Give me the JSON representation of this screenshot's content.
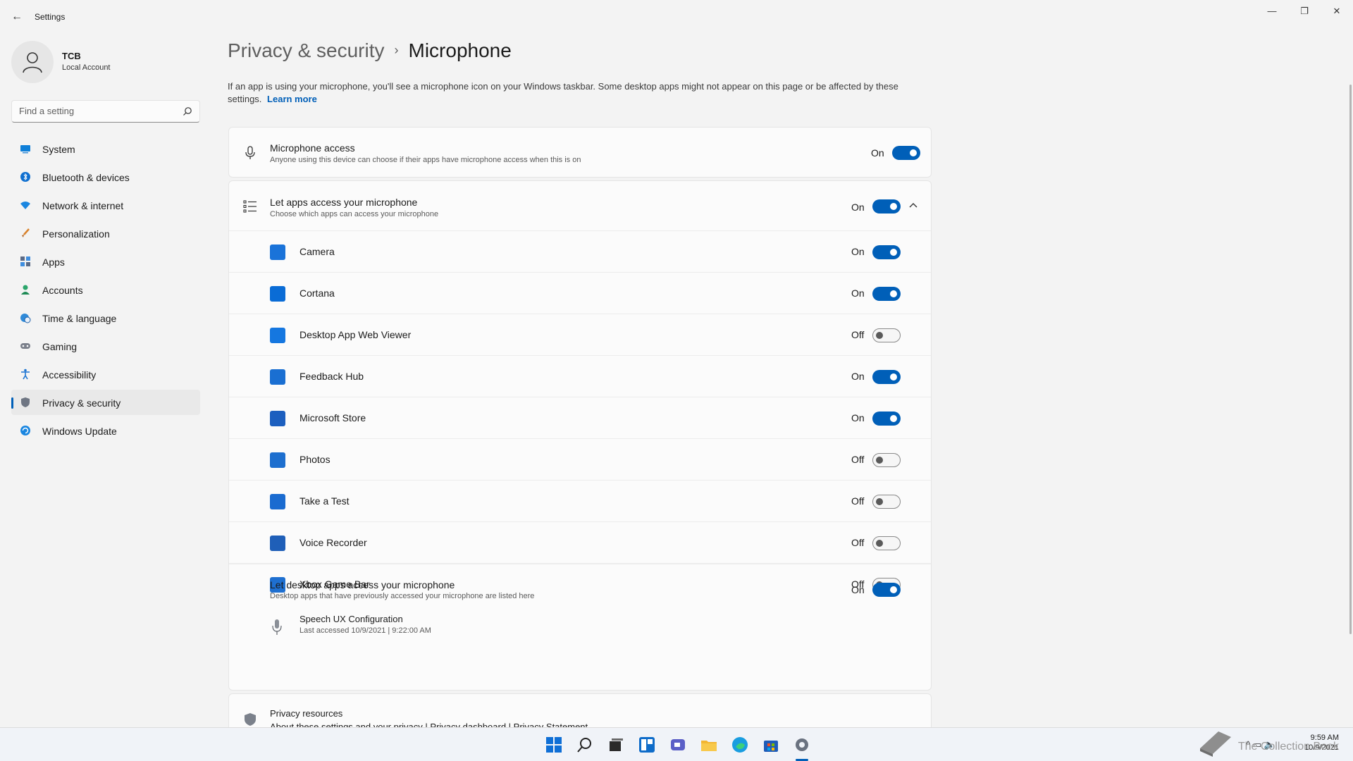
{
  "window": {
    "title": "Settings",
    "back_glyph": "←",
    "min_glyph": "—",
    "max_glyph": "❐",
    "close_glyph": "✕"
  },
  "profile": {
    "name": "TCB",
    "account_type": "Local Account"
  },
  "search": {
    "placeholder": "Find a setting"
  },
  "sidebar": {
    "items": [
      {
        "label": "System",
        "icon": "system-icon"
      },
      {
        "label": "Bluetooth & devices",
        "icon": "bluetooth-icon"
      },
      {
        "label": "Network & internet",
        "icon": "network-icon"
      },
      {
        "label": "Personalization",
        "icon": "brush-icon"
      },
      {
        "label": "Apps",
        "icon": "apps-icon"
      },
      {
        "label": "Accounts",
        "icon": "person-icon"
      },
      {
        "label": "Time & language",
        "icon": "globe-clock-icon"
      },
      {
        "label": "Gaming",
        "icon": "controller-icon"
      },
      {
        "label": "Accessibility",
        "icon": "accessibility-icon"
      },
      {
        "label": "Privacy & security",
        "icon": "shield-icon",
        "active": true
      },
      {
        "label": "Windows Update",
        "icon": "update-icon"
      }
    ]
  },
  "breadcrumb": {
    "parent": "Privacy & security",
    "separator": "›",
    "current": "Microphone"
  },
  "description": {
    "text": "If an app is using your microphone, you'll see a microphone icon on your Windows taskbar. Some desktop apps might not appear on this page or be affected by these settings.",
    "link": "Learn more"
  },
  "microphone_access": {
    "title": "Microphone access",
    "subtitle": "Anyone using this device can choose if their apps have microphone access when this is on",
    "state": "On"
  },
  "let_apps": {
    "title": "Let apps access your microphone",
    "subtitle": "Choose which apps can access your microphone",
    "state": "On",
    "chevron": "^"
  },
  "apps": [
    {
      "name": "Camera",
      "state": "On",
      "on": true,
      "color": "#1a73d9"
    },
    {
      "name": "Cortana",
      "state": "On",
      "on": true,
      "color": "#0a6cd6"
    },
    {
      "name": "Desktop App Web Viewer",
      "state": "Off",
      "on": false,
      "color": "#1577e0"
    },
    {
      "name": "Feedback Hub",
      "state": "On",
      "on": true,
      "color": "#1a6fd2"
    },
    {
      "name": "Microsoft Store",
      "state": "On",
      "on": true,
      "color": "#1c5fbf"
    },
    {
      "name": "Photos",
      "state": "Off",
      "on": false,
      "color": "#1d6fcf"
    },
    {
      "name": "Take a Test",
      "state": "Off",
      "on": false,
      "color": "#1a6bd0"
    },
    {
      "name": "Voice Recorder",
      "state": "Off",
      "on": false,
      "color": "#1f5fb8"
    },
    {
      "name": "Xbox Game Bar",
      "state": "Off",
      "on": false,
      "color": "#1e6fd0"
    }
  ],
  "desktop_apps": {
    "title": "Let desktop apps access your microphone",
    "subtitle": "Desktop apps that have previously accessed your microphone are listed here",
    "state": "On",
    "entry_name": "Speech UX Configuration",
    "entry_detail": "Last accessed 10/9/2021  |  9:22:00 AM"
  },
  "privacy_resources": {
    "title": "Privacy resources",
    "links": "About these settings and your privacy | Privacy dashboard | Privacy Statement"
  },
  "taskbar": {
    "time": "9:59 AM",
    "date": "10/9/2021",
    "watermark": "The Collection Book"
  },
  "colors": {
    "accent": "#005fb8",
    "background": "#f3f3f3",
    "card": "#fbfbfb"
  }
}
